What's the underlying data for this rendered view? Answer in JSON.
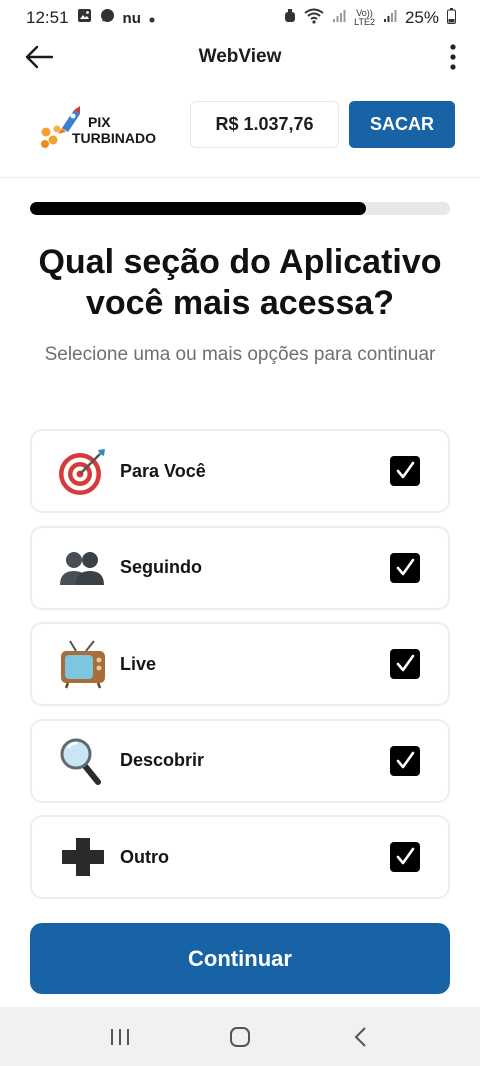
{
  "status_bar": {
    "time": "12:51",
    "nu_label": "nu",
    "battery": "25%",
    "volte_line1": "Vo))",
    "volte_line2": "LTE2"
  },
  "app_bar": {
    "title": "WebView"
  },
  "header": {
    "logo_line1": "PIX",
    "logo_line2": "TURBINADO",
    "balance": "R$ 1.037,76",
    "withdraw_label": "SACAR"
  },
  "progress": {
    "fraction": 0.8
  },
  "quiz": {
    "question": "Qual seção do Aplicativo você mais acessa?",
    "subtitle": "Selecione uma ou mais opções para continuar",
    "options": [
      {
        "label": "Para Você",
        "icon": "target-icon",
        "checked": true
      },
      {
        "label": "Seguindo",
        "icon": "people-icon",
        "checked": true
      },
      {
        "label": "Live",
        "icon": "tv-icon",
        "checked": true
      },
      {
        "label": "Descobrir",
        "icon": "magnifier-icon",
        "checked": true
      },
      {
        "label": "Outro",
        "icon": "plus-icon",
        "checked": true
      }
    ],
    "continue_label": "Continuar"
  },
  "colors": {
    "accent": "#1763a6",
    "progress": "#000000",
    "track": "#e8e8e8"
  }
}
